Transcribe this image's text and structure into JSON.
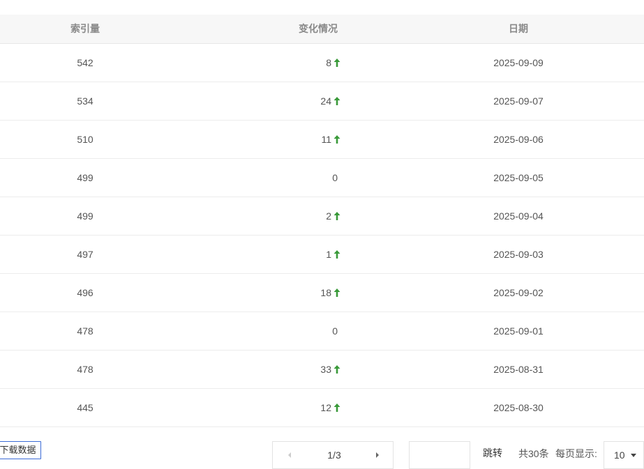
{
  "table": {
    "headers": [
      "索引量",
      "变化情况",
      "日期"
    ],
    "rows": [
      {
        "index": "542",
        "change": "8",
        "up": true,
        "date": "2025-09-09"
      },
      {
        "index": "534",
        "change": "24",
        "up": true,
        "date": "2025-09-07"
      },
      {
        "index": "510",
        "change": "11",
        "up": true,
        "date": "2025-09-06"
      },
      {
        "index": "499",
        "change": "0",
        "up": false,
        "date": "2025-09-05"
      },
      {
        "index": "499",
        "change": "2",
        "up": true,
        "date": "2025-09-04"
      },
      {
        "index": "497",
        "change": "1",
        "up": true,
        "date": "2025-09-03"
      },
      {
        "index": "496",
        "change": "18",
        "up": true,
        "date": "2025-09-02"
      },
      {
        "index": "478",
        "change": "0",
        "up": false,
        "date": "2025-09-01"
      },
      {
        "index": "478",
        "change": "33",
        "up": true,
        "date": "2025-08-31"
      },
      {
        "index": "445",
        "change": "12",
        "up": true,
        "date": "2025-08-30"
      }
    ]
  },
  "footer": {
    "download_label": "下载数据",
    "pagination": {
      "page_text": "1/3",
      "prev_icon": "chevron-left-icon",
      "next_icon": "chevron-right-icon"
    },
    "jump_input_value": "",
    "jump_label": "跳转",
    "total_text": "共30条",
    "per_page_label": "每页显示:",
    "per_page_value": "10"
  },
  "colors": {
    "up_arrow": "#3a9a3a",
    "header_bg": "#f7f7f7",
    "download_border": "#3b6bd6"
  }
}
